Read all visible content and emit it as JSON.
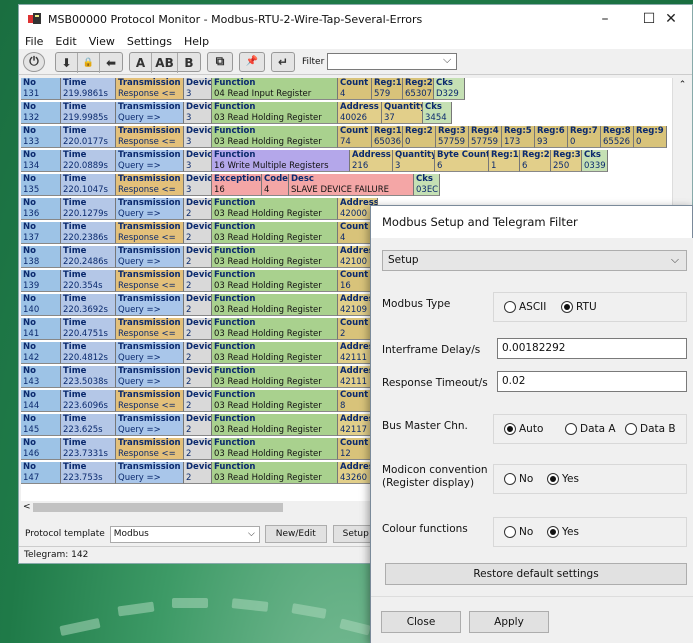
{
  "window": {
    "title": "MSB00000 Protocol Monitor - Modbus-RTU-2-Wire-Tap-Several-Errors",
    "min": "–",
    "max": "☐",
    "close": "✕"
  },
  "menu": [
    "File",
    "Edit",
    "View",
    "Settings",
    "Help"
  ],
  "toolbar": {
    "power": "⏻",
    "group1": [
      "⬇",
      "🔒",
      "⬅"
    ],
    "group2": [
      "A",
      "AB",
      "B"
    ],
    "copy": "⧉",
    "pin": "📌",
    "enter": "↵",
    "filter_label": "Filter",
    "filter_value": ""
  },
  "colors": {
    "no": "#9dc3e6",
    "time": "#b4c7e7",
    "response": "#e3c07a",
    "query": "#a9c6ea",
    "device": "#d9d9d9",
    "read": "#a9d18e",
    "write": "#b4a7ea",
    "exception": "#f4a6a6",
    "data": "#d8c37a",
    "cks": "#c5e0b4",
    "query_data": "#e2cf8a"
  },
  "table": {
    "rows": [
      {
        "no": "131",
        "time": "219.9861s",
        "tx": "Response <=",
        "dev": "3",
        "fn": "04 Read Input Register",
        "kind": "resp",
        "ftype": "read",
        "extra": [
          {
            "h": "Count",
            "v": "4",
            "w": 34
          },
          {
            "h": "Reg:1",
            "v": "579",
            "w": 31
          },
          {
            "h": "Reg:2",
            "v": "65307",
            "w": 31
          },
          {
            "h": "Cks",
            "v": "D329",
            "w": 31,
            "k": "cks"
          }
        ]
      },
      {
        "no": "132",
        "time": "219.9985s",
        "tx": "Query =>",
        "dev": "3",
        "fn": "03 Read Holding Register",
        "kind": "query",
        "ftype": "read",
        "extra": [
          {
            "h": "Address",
            "v": "40026",
            "w": 44
          },
          {
            "h": "Quantity",
            "v": "37",
            "w": 41
          },
          {
            "h": "Cks",
            "v": "3454",
            "w": 29,
            "k": "cks"
          }
        ]
      },
      {
        "no": "133",
        "time": "220.0177s",
        "tx": "Response <=",
        "dev": "3",
        "fn": "03 Read Holding Register",
        "kind": "resp",
        "ftype": "read",
        "extra": [
          {
            "h": "Count",
            "v": "74",
            "w": 34
          },
          {
            "h": "Reg:1",
            "v": "65036",
            "w": 31
          },
          {
            "h": "Reg:2",
            "v": "0",
            "w": 33
          },
          {
            "h": "Reg:3",
            "v": "57759",
            "w": 33
          },
          {
            "h": "Reg:4",
            "v": "57759",
            "w": 33
          },
          {
            "h": "Reg:5",
            "v": "173",
            "w": 33
          },
          {
            "h": "Reg:6",
            "v": "93",
            "w": 33
          },
          {
            "h": "Reg:7",
            "v": "0",
            "w": 33
          },
          {
            "h": "Reg:8",
            "v": "65526",
            "w": 33
          },
          {
            "h": "Reg:9",
            "v": "0",
            "w": 33
          }
        ]
      },
      {
        "no": "134",
        "time": "220.0889s",
        "tx": "Query =>",
        "dev": "3",
        "fn": "16 Write Multiple Registers",
        "kind": "query",
        "ftype": "write",
        "extra": [
          {
            "h": "Address",
            "v": "216",
            "w": 43
          },
          {
            "h": "Quantity",
            "v": "3",
            "w": 42
          },
          {
            "h": "Byte Count",
            "v": "6",
            "w": 54
          },
          {
            "h": "Reg:1",
            "v": "1",
            "w": 31
          },
          {
            "h": "Reg:2",
            "v": "6",
            "w": 31
          },
          {
            "h": "Reg:3",
            "v": "250",
            "w": 31
          },
          {
            "h": "Cks",
            "v": "0339",
            "w": 26,
            "k": "cks"
          }
        ]
      },
      {
        "no": "135",
        "time": "220.1047s",
        "tx": "Response <=",
        "dev": "3",
        "fn": "",
        "kind": "resp",
        "ftype": "exception",
        "exc": {
          "h1": "Exception",
          "v1": "16",
          "h2": "Code",
          "v2": "4",
          "h3": "Desc",
          "v3": "SLAVE DEVICE FAILURE",
          "hc": "Cks",
          "vc": "03EC"
        }
      },
      {
        "no": "136",
        "time": "220.1279s",
        "tx": "Query =>",
        "dev": "2",
        "fn": "03 Read Holding Register",
        "kind": "query",
        "ftype": "read",
        "extra": [
          {
            "h": "Address",
            "v": "42000",
            "w": 40
          }
        ]
      },
      {
        "no": "137",
        "time": "220.2386s",
        "tx": "Response <=",
        "dev": "2",
        "fn": "03 Read Holding Register",
        "kind": "resp",
        "ftype": "read",
        "extra": [
          {
            "h": "Count",
            "v": "4",
            "w": 40
          }
        ]
      },
      {
        "no": "138",
        "time": "220.2486s",
        "tx": "Query =>",
        "dev": "2",
        "fn": "03 Read Holding Register",
        "kind": "query",
        "ftype": "read",
        "extra": [
          {
            "h": "Address",
            "v": "42100",
            "w": 40
          }
        ]
      },
      {
        "no": "139",
        "time": "220.354s",
        "tx": "Response <=",
        "dev": "2",
        "fn": "03 Read Holding Register",
        "kind": "resp",
        "ftype": "read",
        "extra": [
          {
            "h": "Count",
            "v": "16",
            "w": 40
          }
        ]
      },
      {
        "no": "140",
        "time": "220.3692s",
        "tx": "Query =>",
        "dev": "2",
        "fn": "03 Read Holding Register",
        "kind": "query",
        "ftype": "read",
        "extra": [
          {
            "h": "Address",
            "v": "42109",
            "w": 40
          }
        ]
      },
      {
        "no": "141",
        "time": "220.4751s",
        "tx": "Response <=",
        "dev": "2",
        "fn": "03 Read Holding Register",
        "kind": "resp",
        "ftype": "read",
        "extra": [
          {
            "h": "Count",
            "v": "2",
            "w": 40
          }
        ]
      },
      {
        "no": "142",
        "time": "220.4812s",
        "tx": "Query =>",
        "dev": "2",
        "fn": "03 Read Holding Register",
        "kind": "query",
        "ftype": "read",
        "extra": [
          {
            "h": "Address",
            "v": "42111",
            "w": 40
          }
        ]
      },
      {
        "no": "143",
        "time": "223.5038s",
        "tx": "Query =>",
        "dev": "2",
        "fn": "03 Read Holding Register",
        "kind": "query",
        "ftype": "read",
        "extra": [
          {
            "h": "Address",
            "v": "42111",
            "w": 40
          }
        ]
      },
      {
        "no": "144",
        "time": "223.6096s",
        "tx": "Response <=",
        "dev": "2",
        "fn": "03 Read Holding Register",
        "kind": "resp",
        "ftype": "read",
        "extra": [
          {
            "h": "Count",
            "v": "8",
            "w": 40
          }
        ]
      },
      {
        "no": "145",
        "time": "223.625s",
        "tx": "Query =>",
        "dev": "2",
        "fn": "03 Read Holding Register",
        "kind": "query",
        "ftype": "read",
        "extra": [
          {
            "h": "Address",
            "v": "42117",
            "w": 40
          }
        ]
      },
      {
        "no": "146",
        "time": "223.7331s",
        "tx": "Response <=",
        "dev": "2",
        "fn": "03 Read Holding Register",
        "kind": "resp",
        "ftype": "read",
        "extra": [
          {
            "h": "Count",
            "v": "12",
            "w": 40
          }
        ]
      },
      {
        "no": "147",
        "time": "223.753s",
        "tx": "Query =>",
        "dev": "2",
        "fn": "03 Read Holding Register",
        "kind": "query",
        "ftype": "read",
        "extra": [
          {
            "h": "Address",
            "v": "43260",
            "w": 40
          }
        ]
      }
    ],
    "headers": {
      "no": "No",
      "time": "Time",
      "tx": "Transmission",
      "dev": "Device",
      "fn": "Function"
    }
  },
  "bottom": {
    "template_label": "Protocol template",
    "template_value": "Modbus",
    "newedit": "New/Edit",
    "setup": "Setup"
  },
  "status": "Telegram: 142",
  "dialog": {
    "title": "Modbus Setup and Telegram Filter",
    "section": "Setup",
    "modbus_type": {
      "label": "Modbus Type",
      "opt1": "ASCII",
      "opt2": "RTU"
    },
    "interframe": {
      "label": "Interframe Delay/s",
      "value": "0.00182292"
    },
    "timeout": {
      "label": "Response Timeout/s",
      "value": "0.02"
    },
    "bus_master": {
      "label": "Bus Master Chn.",
      "opt1": "Auto",
      "opt2": "Data A",
      "opt3": "Data B"
    },
    "modicon": {
      "label1": "Modicon convention",
      "label2": "(Register display)",
      "opt1": "No",
      "opt2": "Yes"
    },
    "colour": {
      "label": "Colour functions",
      "opt1": "No",
      "opt2": "Yes"
    },
    "restore": "Restore default settings",
    "close": "Close",
    "apply": "Apply"
  }
}
